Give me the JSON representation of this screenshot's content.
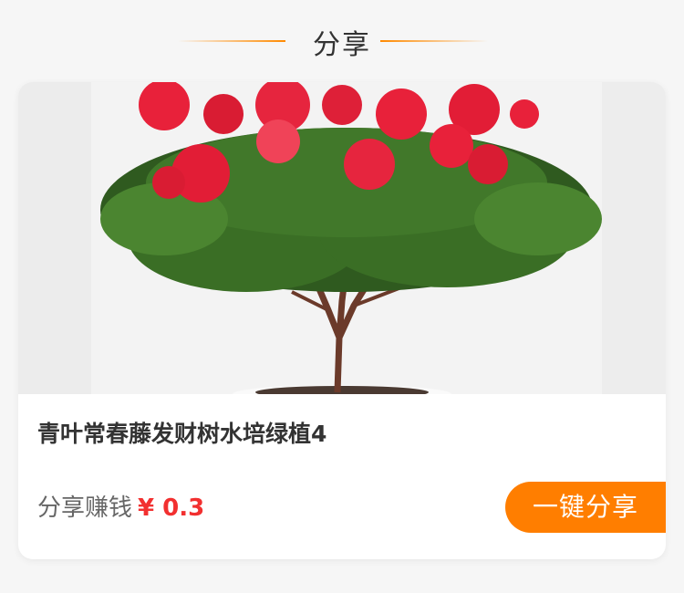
{
  "header": {
    "title": "分享"
  },
  "product": {
    "image_alt": "red azalea bonsai tree",
    "name": "青叶常春藤发财树水培绿植4",
    "earn_label": "分享赚钱",
    "price": "¥ 0.3"
  },
  "actions": {
    "share_label": "一键分享"
  },
  "colors": {
    "accent": "#ff7e00",
    "price": "#f23030"
  }
}
